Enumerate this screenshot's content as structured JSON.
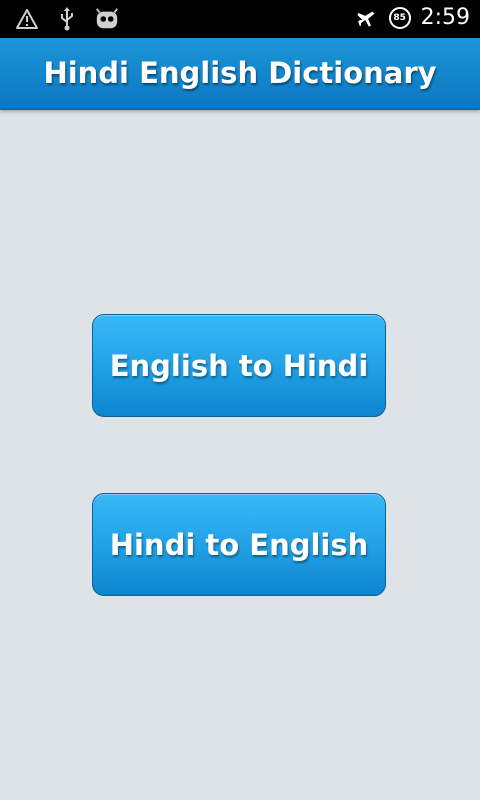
{
  "status_bar": {
    "time": "2:59",
    "battery": "85",
    "left_icons": [
      "warning-icon",
      "usb-icon",
      "android-robot-icon"
    ],
    "right_icons": [
      "airplane-mode-icon",
      "battery-icon"
    ]
  },
  "header": {
    "title": "Hindi English Dictionary"
  },
  "main": {
    "buttons": [
      {
        "label": "English to Hindi"
      },
      {
        "label": "Hindi to English"
      }
    ]
  },
  "colors": {
    "background": "#dde3e7",
    "header": "#0b78c2",
    "button": "#22a2e6"
  }
}
